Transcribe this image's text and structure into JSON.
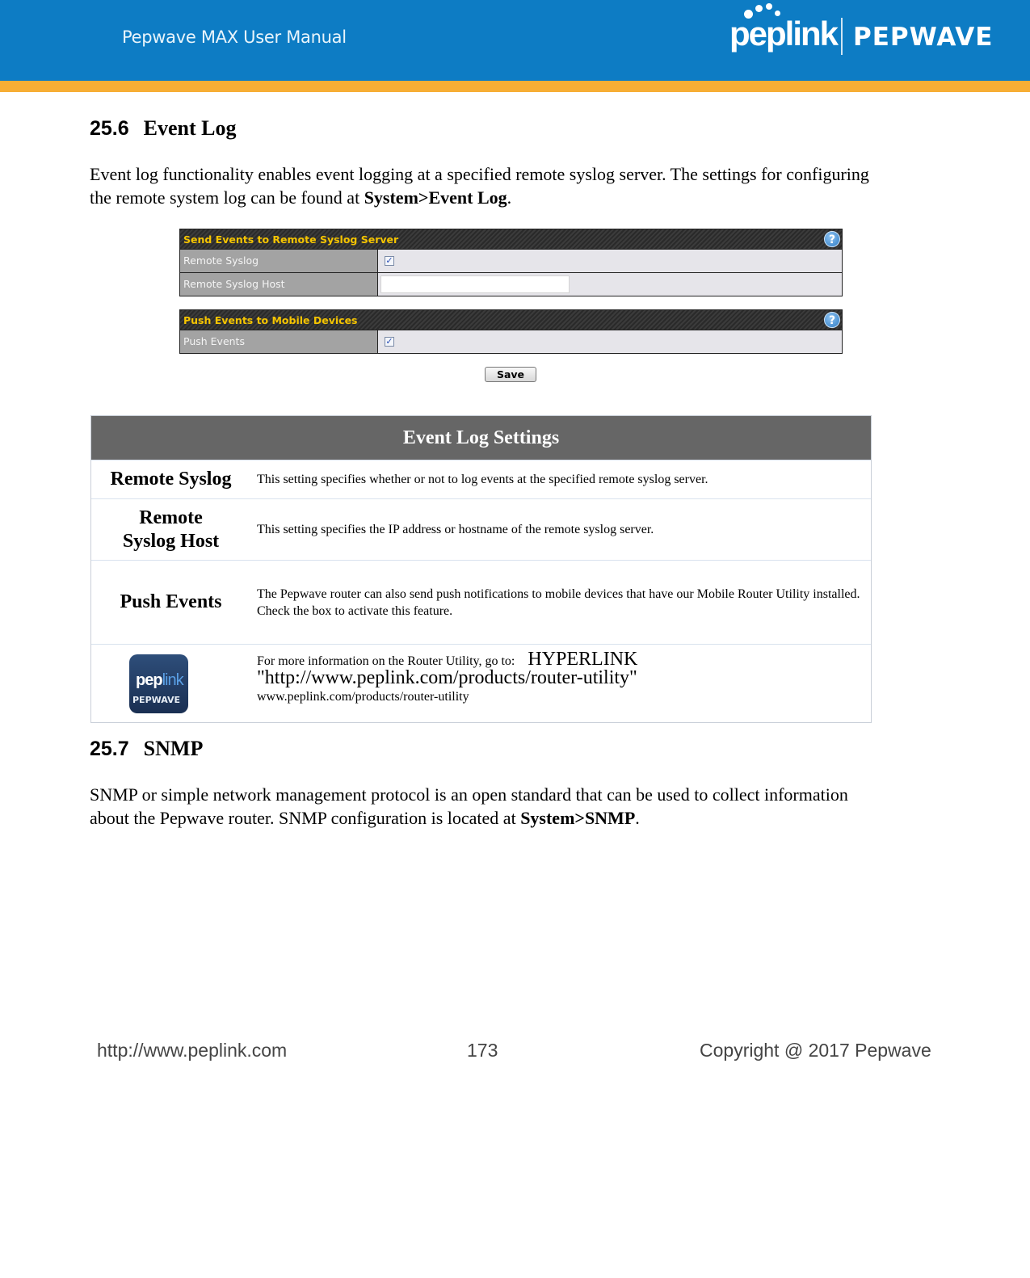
{
  "header": {
    "manual_title": "Pepwave MAX User Manual",
    "logo_left": "peplink",
    "logo_right": "PEPWAVE",
    "colors": {
      "banner": "#0d7cc4",
      "stripe": "#f7ae35"
    }
  },
  "section_event_log": {
    "number": "25.6",
    "title": "Event Log",
    "intro_text": "Event log functionality enables event logging at a specified remote syslog server. The settings for configuring the remote system log can be found at ",
    "intro_path": "System>Event Log",
    "intro_end": "."
  },
  "ui_screenshot": {
    "panel1": {
      "title": "Send Events to Remote Syslog Server",
      "help_icon": "?",
      "rows": [
        {
          "label": "Remote Syslog",
          "type": "checkbox",
          "checked": true
        },
        {
          "label": "Remote Syslog Host",
          "type": "text",
          "value": ""
        }
      ]
    },
    "panel2": {
      "title": "Push Events to Mobile Devices",
      "help_icon": "?",
      "rows": [
        {
          "label": "Push Events",
          "type": "checkbox",
          "checked": true
        }
      ]
    },
    "checkmark": "✓",
    "save_label": "Save"
  },
  "settings_table": {
    "title": "Event Log Settings",
    "rows": [
      {
        "name": "Remote Syslog",
        "desc": "This setting specifies whether or not to log events at the specified remote syslog server."
      },
      {
        "name": "Remote Syslog Host",
        "desc": "This setting specifies the IP address or hostname of the remote syslog server."
      },
      {
        "name": "Push Events",
        "desc": "The Pepwave router can also send push notifications to mobile devices that have our Mobile Router Utility installed. Check the box to activate this feature."
      }
    ],
    "info_row": {
      "icon_top": "peplink",
      "icon_bottom": "PEPWAVE",
      "lead": "For more information on the Router Utility, go to:",
      "hyperlink_field": "HYPERLINK",
      "hyperlink_url": "\"http://www.peplink.com/products/router-utility\"",
      "link_text": "www.peplink.com/products/router-utility"
    }
  },
  "section_snmp": {
    "number": "25.7",
    "title": "SNMP",
    "intro_text": "SNMP or simple network management protocol is an open standard that can be used to collect information about the Pepwave router. SNMP configuration is located at ",
    "intro_path": "System>SNMP",
    "intro_end": "."
  },
  "footer": {
    "url": "http://www.peplink.com",
    "page_number": "173",
    "copyright": "Copyright @ 2017 Pepwave"
  }
}
